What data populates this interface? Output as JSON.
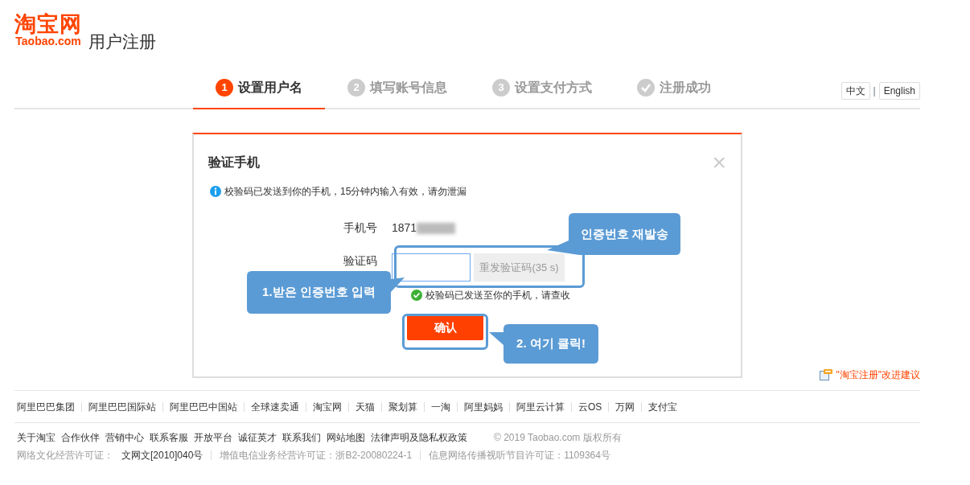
{
  "logo": {
    "name": "淘宝网",
    "domain": "Taobao.com"
  },
  "page_title": "用户注册",
  "steps": [
    {
      "kind": "number",
      "number": "1",
      "label": "设置用户名",
      "selected": true
    },
    {
      "kind": "number",
      "number": "2",
      "label": "填写账号信息",
      "selected": false
    },
    {
      "kind": "number",
      "number": "3",
      "label": "设置支付方式",
      "selected": false
    },
    {
      "kind": "check",
      "label": "注册成功",
      "selected": false
    }
  ],
  "languages": [
    {
      "label": "中文"
    },
    {
      "label": "English"
    }
  ],
  "language_separator": "|",
  "dialog": {
    "title": "验证手机",
    "close": "×",
    "info_message": "校验码已发送到你的手机，15分钟内输入有效，请勿泄漏",
    "phone": {
      "label": "手机号",
      "value": "1871"
    },
    "code": {
      "label": "验证码",
      "resend_button": "重发验证码(35 s)",
      "disabled": true
    },
    "success_message": "校验码已发送至你的手机，请查收",
    "confirm_button": "确认"
  },
  "annotations": [
    {
      "text": "인증번호 재발송"
    },
    {
      "text": "1.받은 인증번호 입력"
    },
    {
      "text": "2. 여기 클릭!"
    }
  ],
  "feedback_link": "\"淘宝注册\"改进建议",
  "footer": {
    "partner_links": [
      "阿里巴巴集团",
      "阿里巴巴国际站",
      "阿里巴巴中国站",
      "全球速卖通",
      "淘宝网",
      "天猫",
      "聚划算",
      "一淘",
      "阿里妈妈",
      "阿里云计算",
      "云OS",
      "万网",
      "支付宝"
    ],
    "about_links": [
      "关于淘宝",
      "合作伙伴",
      "营销中心",
      "联系客服",
      "开放平台",
      "诚征英才",
      "联系我们",
      "网站地图",
      "法律声明及隐私权政策"
    ],
    "copyright": "© 2019 Taobao.com 版权所有",
    "licenses": [
      {
        "label": "网络文化经营许可证：",
        "value": "文网文[2010]040号"
      },
      {
        "label": "增值电信业务经营许可证：",
        "value": "浙B2-20080224-1"
      },
      {
        "label": "信息网络传播视听节目许可证：",
        "value": "1109364号"
      }
    ]
  }
}
